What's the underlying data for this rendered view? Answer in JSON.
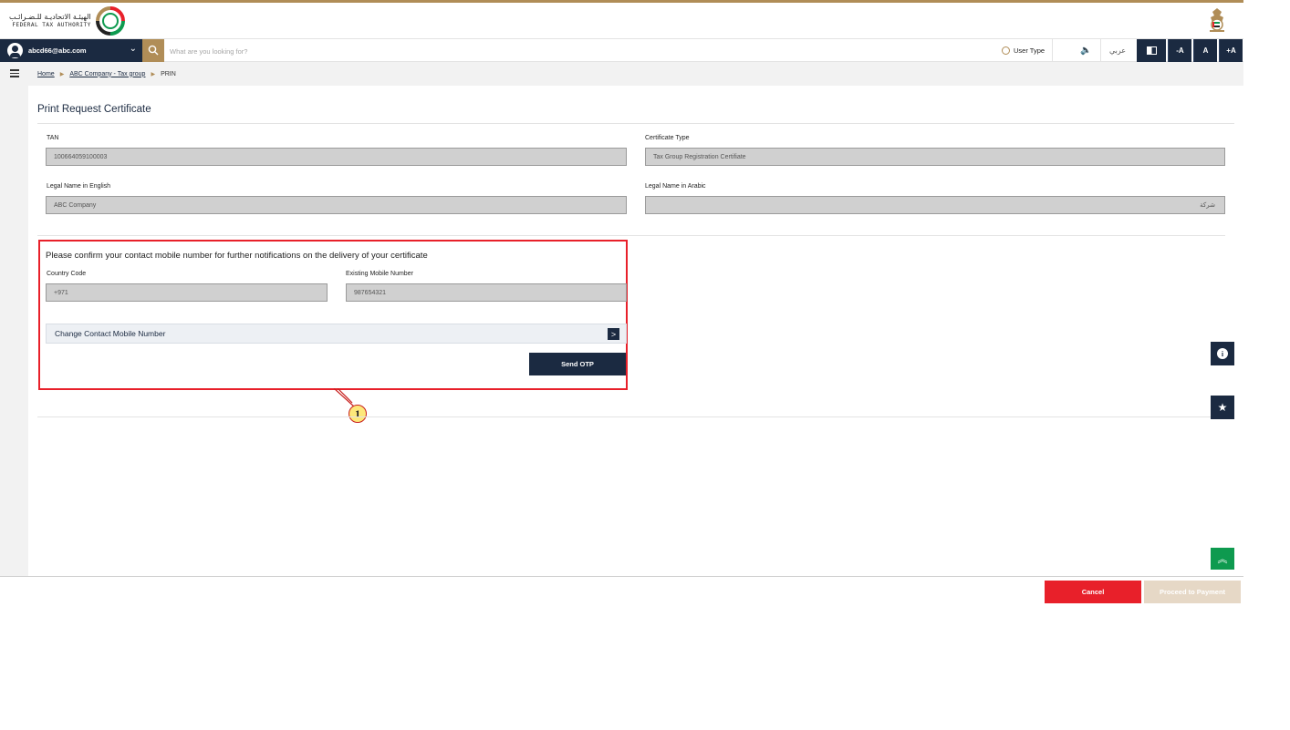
{
  "header": {
    "logo_arabic": "الهيئـة الاتحاديـة للـضـرائـب",
    "logo_english": "FEDERAL TAX AUTHORITY",
    "emblem_icon": "uae-emblem-icon"
  },
  "navbar": {
    "user_email": "abcd66@abc.com",
    "search_placeholder": "What are you looking for?",
    "user_type_label": "User Type",
    "sound_glyph": "🔈",
    "language_label": "عربي",
    "font_decrease": "-A",
    "font_normal": "A",
    "font_increase": "+A"
  },
  "breadcrumb": {
    "home": "Home",
    "group": "ABC Company - Tax group",
    "current": "PRIN"
  },
  "page": {
    "title": "Print Request Certificate"
  },
  "form": {
    "tan_label": "TAN",
    "tan_value": "100664059100003",
    "cert_type_label": "Certificate Type",
    "cert_type_value": "Tax Group Registration Certifiate",
    "legal_en_label": "Legal Name in English",
    "legal_en_value": "ABC Company",
    "legal_ar_label": "Legal Name in Arabic",
    "legal_ar_value": "شركة"
  },
  "contact": {
    "title": "Please confirm your contact mobile number for further notifications on the delivery of your certificate",
    "country_code_label": "Country Code",
    "country_code_value": "+971",
    "mobile_label": "Existing Mobile Number",
    "mobile_value": "987654321",
    "change_label": "Change Contact Mobile Number",
    "change_arrow": ">",
    "send_otp": "Send OTP"
  },
  "callout": {
    "number": "1"
  },
  "side": {
    "info_glyph": "i",
    "star_glyph": "★",
    "top_glyph": "︽"
  },
  "footer": {
    "cancel": "Cancel",
    "proceed": "Proceed to Payment"
  },
  "colors": {
    "brand_navy": "#1b2a41",
    "brand_gold": "#b08d57",
    "danger_red": "#e8202a",
    "success_green": "#0e9a4f"
  }
}
